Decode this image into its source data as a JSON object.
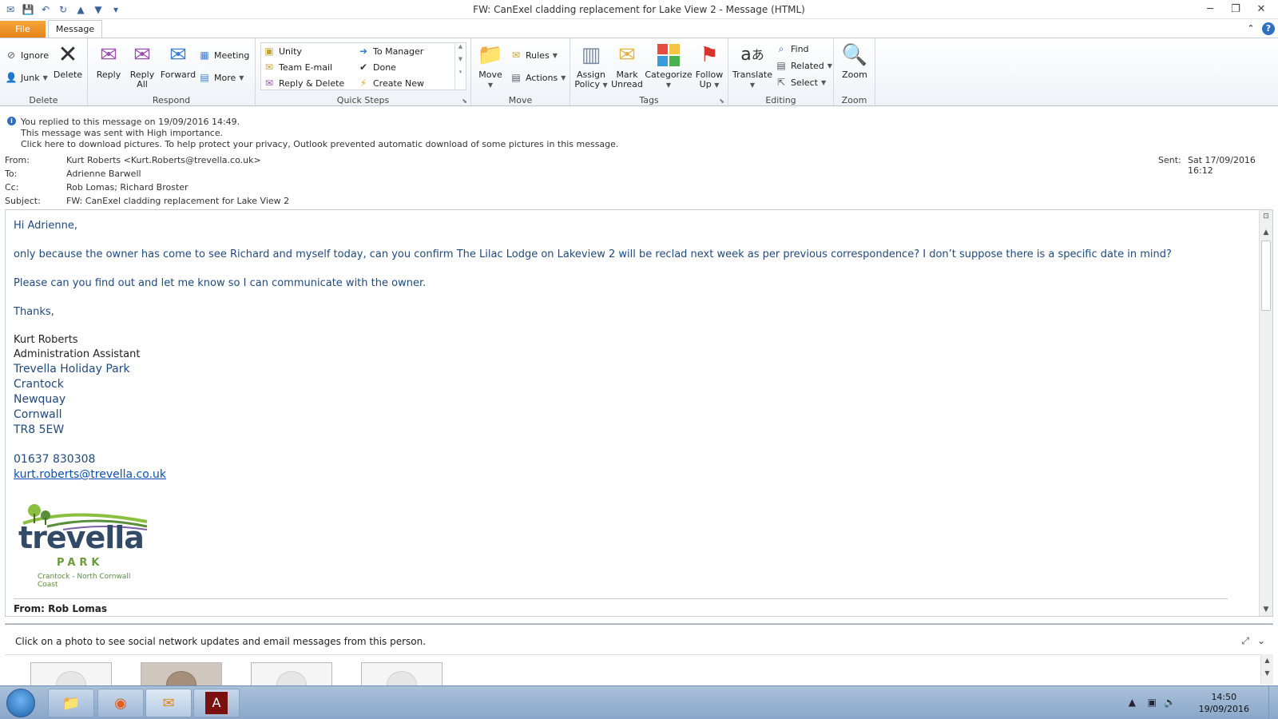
{
  "window": {
    "title": "FW: CanExel cladding replacement for Lake View 2  -  Message (HTML)"
  },
  "tabs": {
    "file": "File",
    "message": "Message"
  },
  "ribbon": {
    "delete": {
      "label": "Delete",
      "ignore": "Ignore",
      "junk": "Junk",
      "delete_btn": "Delete"
    },
    "respond": {
      "label": "Respond",
      "reply": "Reply",
      "reply_all_1": "Reply",
      "reply_all_2": "All",
      "forward": "Forward",
      "meeting": "Meeting",
      "more": "More"
    },
    "quick_steps": {
      "label": "Quick Steps",
      "unity": "Unity",
      "team_email": "Team E-mail",
      "reply_delete": "Reply & Delete",
      "to_manager": "To Manager",
      "done": "Done",
      "create_new": "Create New"
    },
    "move": {
      "label": "Move",
      "move_btn": "Move",
      "rules": "Rules",
      "actions": "Actions"
    },
    "tags": {
      "label": "Tags",
      "assign_1": "Assign",
      "assign_2": "Policy",
      "mark_1": "Mark",
      "mark_2": "Unread",
      "categorize": "Categorize",
      "follow_1": "Follow",
      "follow_2": "Up"
    },
    "editing": {
      "label": "Editing",
      "translate": "Translate",
      "find": "Find",
      "related": "Related",
      "select": "Select"
    },
    "zoom": {
      "label": "Zoom",
      "zoom_btn": "Zoom"
    }
  },
  "info": {
    "line1": "You replied to this message on 19/09/2016 14:49.",
    "line2": "This message was sent with High importance.",
    "line3": "Click here to download pictures. To help protect your privacy, Outlook prevented automatic download of some pictures in this message."
  },
  "headers": {
    "from_label": "From:",
    "from": "Kurt Roberts <Kurt.Roberts@trevella.co.uk>",
    "to_label": "To:",
    "to": "Adrienne Barwell",
    "cc_label": "Cc:",
    "cc": "Rob Lomas; Richard Broster",
    "subject_label": "Subject:",
    "subject": "FW: CanExel cladding replacement for Lake View 2",
    "sent_label": "Sent:",
    "sent": "Sat 17/09/2016 16:12"
  },
  "body": {
    "greeting": "Hi Adrienne,",
    "p1": "only because the owner has come to see Richard and myself today, can you confirm The Lilac Lodge on Lakeview 2 will be reclad next week as per previous correspondence? I don’t suppose there is a specific date in mind?",
    "p2": "Please can you find out and let me know so I can communicate with the owner.",
    "thanks": "Thanks,",
    "sig_name": "Kurt Roberts",
    "sig_title": "Administration Assistant",
    "sig_lines": [
      "Trevella Holiday Park",
      "Crantock",
      "Newquay",
      "Cornwall",
      "TR8 5EW"
    ],
    "phone": "01637 830308",
    "email": "kurt.roberts@trevella.co.uk",
    "logo_word": "trevella",
    "logo_sub": "PARK",
    "logo_tag": "Crantock - North Cornwall Coast",
    "fwd_from": "From: Rob Lomas"
  },
  "people_pane": {
    "text": "Click on a photo to see social network updates and email messages from this person."
  },
  "taskbar": {
    "time": "14:50",
    "date": "19/09/2016"
  },
  "colors": {
    "accent": "#2f6fc0",
    "file_tab": "#e8831a",
    "body_text": "#1f497d"
  }
}
